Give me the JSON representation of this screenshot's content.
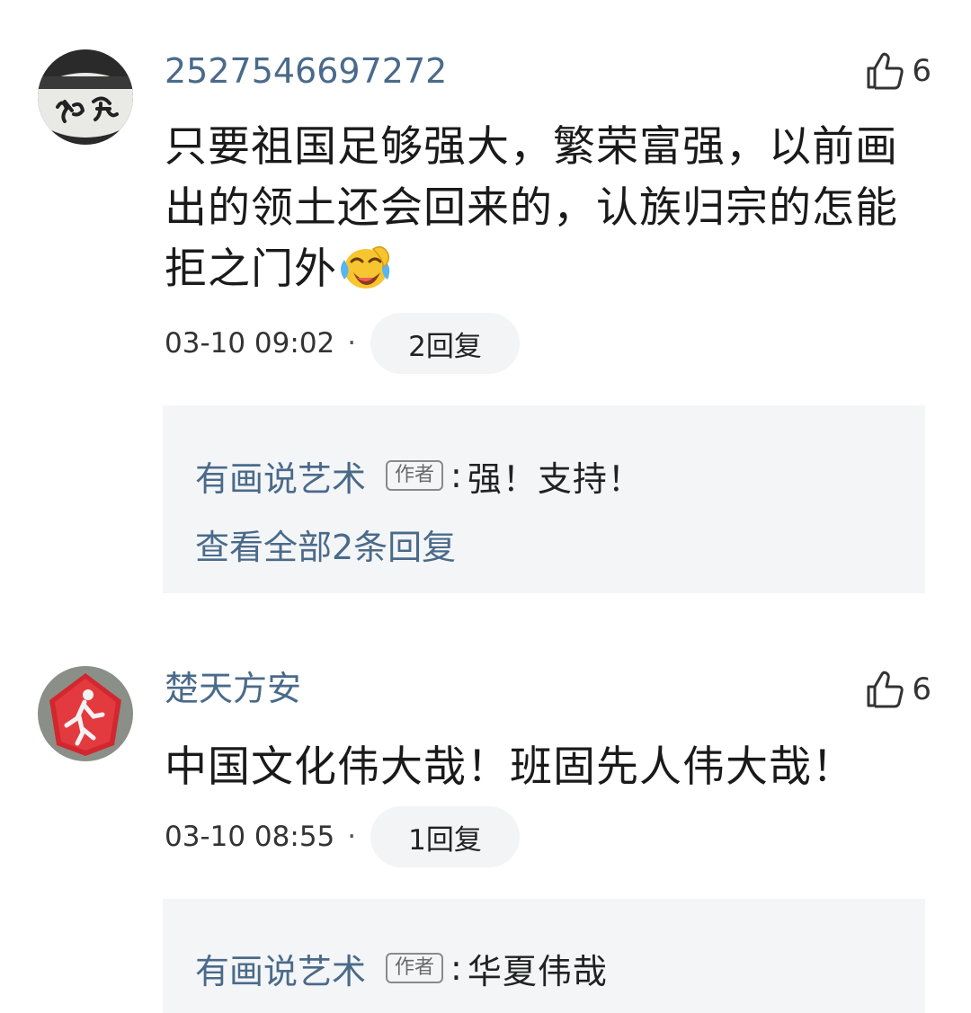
{
  "comments": [
    {
      "username": "2527546697272",
      "avatar_icon": "calligraphy-avatar-icon",
      "like_icon": "thumbs-up-icon",
      "like_count": "6",
      "text_lines": [
        "只要祖国足够强大，繁荣富强，以前画",
        "出的领土还会回来的，认族归宗的怎能",
        "拒之门外"
      ],
      "emoji_icon": "laughing-crying-emoji-icon",
      "timestamp": "03-10 09:02",
      "dot": "·",
      "reply_count_label": "2回复",
      "reply": {
        "author": "有画说艺术",
        "badge": "作者",
        "separator": ":",
        "text": "强！支持！",
        "view_all": "查看全部2条回复"
      }
    },
    {
      "username": "楚天方安",
      "avatar_icon": "red-badge-avatar-icon",
      "like_icon": "thumbs-up-icon",
      "like_count": "6",
      "text_lines": [
        "中国文化伟大哉！班固先人伟大哉！"
      ],
      "timestamp": "03-10 08:55",
      "dot": "·",
      "reply_count_label": "1回复",
      "reply": {
        "author": "有画说艺术",
        "badge": "作者",
        "separator": ":",
        "text": "华夏伟哉"
      }
    }
  ]
}
